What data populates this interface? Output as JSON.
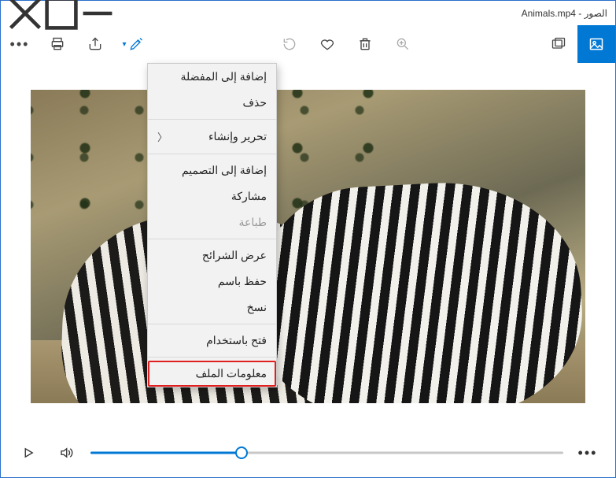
{
  "window": {
    "title": "الصور - Animals.mp4"
  },
  "context_menu": {
    "items": [
      {
        "label": "إضافة إلى المفضلة",
        "type": "item"
      },
      {
        "label": "حذف",
        "type": "item"
      },
      {
        "type": "sep"
      },
      {
        "label": "تحرير وإنشاء",
        "type": "submenu"
      },
      {
        "type": "sep"
      },
      {
        "label": "إضافة إلى التصميم",
        "type": "item"
      },
      {
        "label": "مشاركة",
        "type": "item"
      },
      {
        "label": "طباعة",
        "type": "item",
        "disabled": true
      },
      {
        "type": "sep"
      },
      {
        "label": "عرض الشرائح",
        "type": "item"
      },
      {
        "label": "حفظ باسم",
        "type": "item"
      },
      {
        "label": "نسخ",
        "type": "item"
      },
      {
        "type": "sep"
      },
      {
        "label": "فتح باستخدام",
        "type": "item"
      },
      {
        "type": "sep"
      },
      {
        "label": "معلومات الملف",
        "type": "item",
        "highlight": true
      }
    ]
  },
  "playback": {
    "position_percent": 32
  }
}
